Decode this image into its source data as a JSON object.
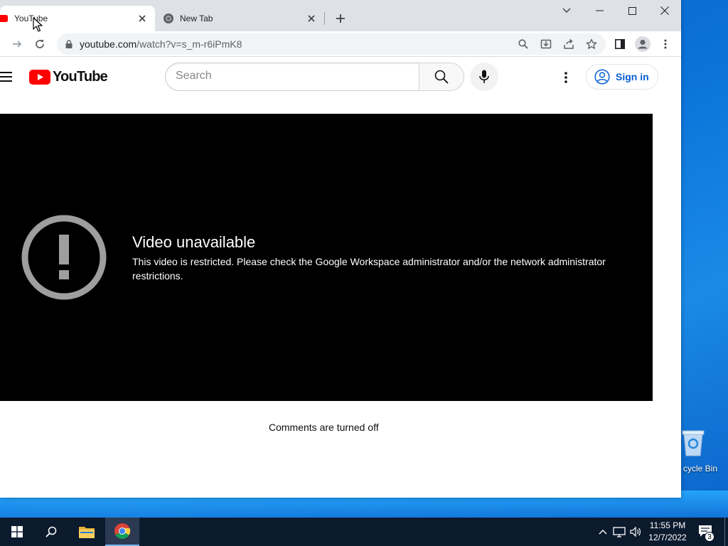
{
  "browser": {
    "tabs": [
      {
        "title": "YouTube",
        "active": true
      },
      {
        "title": "New Tab",
        "active": false
      }
    ],
    "address": {
      "host": "youtube.com",
      "path": "/watch?v=s_m-r6iPmK8"
    }
  },
  "youtube": {
    "logo_text": "YouTube",
    "search_placeholder": "Search",
    "sign_in_label": "Sign in",
    "player": {
      "title": "Video unavailable",
      "message": "This video is restricted. Please check the Google Workspace administrator and/or the network administrator restrictions."
    },
    "comments_text": "Comments are turned off"
  },
  "desktop": {
    "recycle_bin_label": "cycle Bin"
  },
  "taskbar": {
    "time": "11:55 PM",
    "date": "12/7/2022",
    "notification_count": "3"
  },
  "colors": {
    "youtube_red": "#ff0000",
    "link_blue": "#065fd4",
    "desktop_blue": "#0a72d8",
    "taskbar": "#0c1a2e"
  }
}
